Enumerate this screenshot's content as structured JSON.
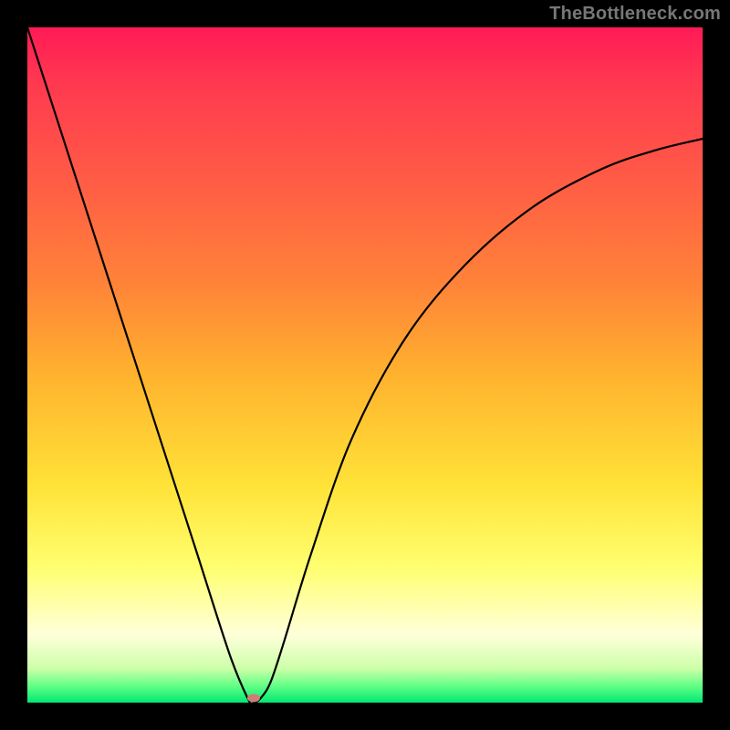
{
  "watermark": "TheBottleneck.com",
  "chart_data": {
    "type": "line",
    "title": "",
    "xlabel": "",
    "ylabel": "",
    "xlim": [
      0,
      1
    ],
    "ylim": [
      0,
      1
    ],
    "series": [
      {
        "name": "bottleneck-curve",
        "x": [
          0.0,
          0.05,
          0.1,
          0.15,
          0.2,
          0.25,
          0.3,
          0.328,
          0.335,
          0.345,
          0.36,
          0.38,
          0.42,
          0.48,
          0.56,
          0.65,
          0.75,
          0.85,
          0.93,
          1.0
        ],
        "values": [
          1.0,
          0.845,
          0.69,
          0.535,
          0.38,
          0.225,
          0.07,
          0.003,
          0.0,
          0.006,
          0.03,
          0.09,
          0.22,
          0.39,
          0.54,
          0.65,
          0.735,
          0.79,
          0.818,
          0.835
        ]
      }
    ],
    "marker": {
      "name": "minimum-marker",
      "x": 0.335,
      "y": 0.0,
      "color": "#d47a7a"
    }
  }
}
